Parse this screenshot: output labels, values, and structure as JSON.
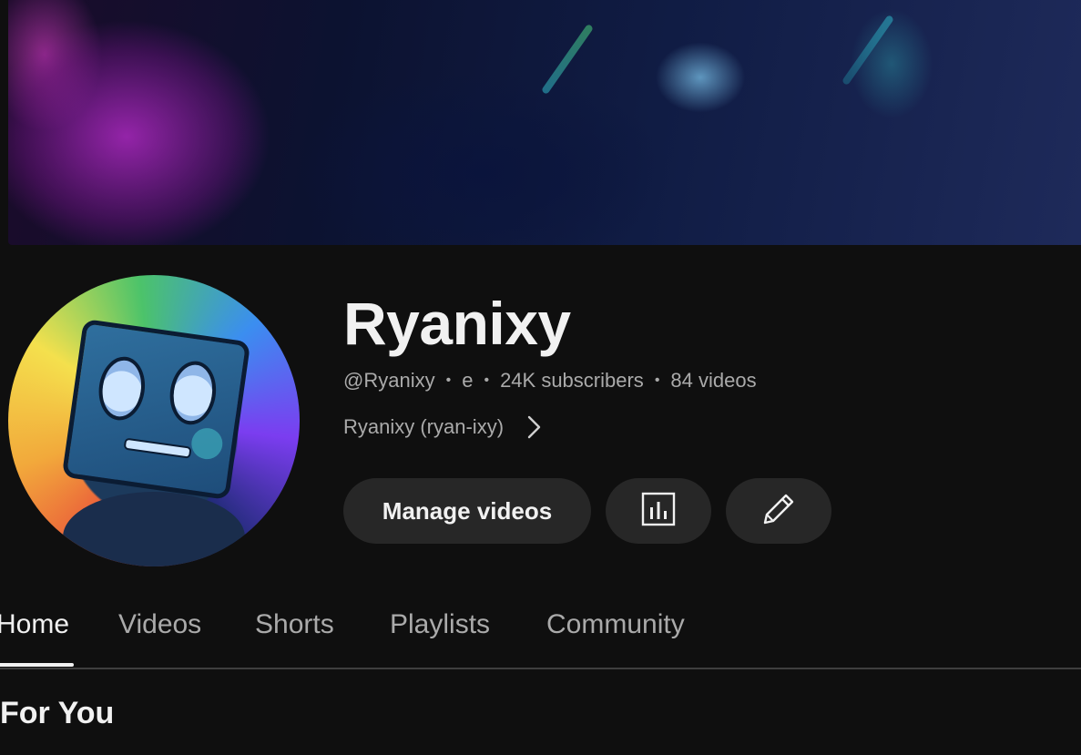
{
  "channel": {
    "name": "Ryanixy",
    "handle": "@Ryanixy",
    "extra": "e",
    "subscribers": "24K subscribers",
    "videos": "84 videos",
    "link_text": "Ryanixy (ryan-ixy)"
  },
  "buttons": {
    "manage_videos": "Manage videos",
    "analytics_icon": "bar-chart-icon",
    "edit_icon": "pencil-icon"
  },
  "tabs": [
    {
      "label": "Home",
      "active": true
    },
    {
      "label": "Videos"
    },
    {
      "label": "Shorts"
    },
    {
      "label": "Playlists"
    },
    {
      "label": "Community"
    }
  ],
  "section": {
    "title": "For You"
  },
  "colors": {
    "background": "#0f0f0f",
    "text_primary": "#f1f1f1",
    "text_secondary": "#aaaaaa",
    "button_bg": "#272727"
  }
}
